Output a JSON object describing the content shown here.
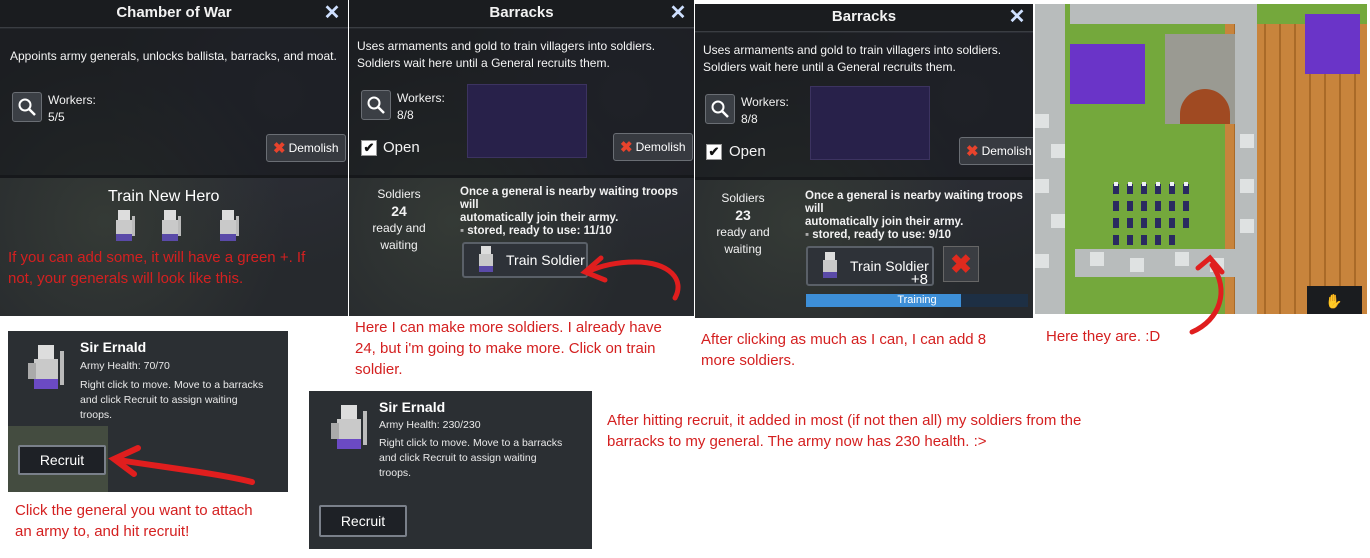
{
  "chamber": {
    "title": "Chamber of War",
    "description": "Appoints army generals, unlocks ballista, barracks, and moat.",
    "workers_label": "Workers:",
    "workers_value": "5/5",
    "demolish_label": "Demolish",
    "train_hero_label": "Train New Hero"
  },
  "barracks1": {
    "title": "Barracks",
    "description_line1": "Uses armaments and gold to train villagers into soldiers.",
    "description_line2": "Soldiers wait here until a General recruits them.",
    "workers_label": "Workers:",
    "workers_value": "8/8",
    "open_label": "Open",
    "demolish_label": "Demolish",
    "soldiers_label": "Soldiers",
    "soldiers_count": "24",
    "soldiers_sub1": "ready and",
    "soldiers_sub2": "waiting",
    "general_text_line1": "Once a general is nearby waiting troops will",
    "general_text_line2": "automatically join their army.",
    "stored_text": "stored, ready to use: 11/10",
    "train_label": "Train Soldier"
  },
  "barracks2": {
    "title": "Barracks",
    "description_line1": "Uses armaments and gold to train villagers into soldiers.",
    "description_line2": "Soldiers wait here until a General recruits them.",
    "workers_label": "Workers:",
    "workers_value": "8/8",
    "open_label": "Open",
    "demolish_label": "Demolish",
    "soldiers_label": "Soldiers",
    "soldiers_count": "23",
    "soldiers_sub1": "ready and",
    "soldiers_sub2": "waiting",
    "general_text_line1": "Once a general is nearby waiting troops will",
    "general_text_line2": "automatically join their army.",
    "stored_text": "stored, ready to use: 9/10",
    "train_label": "Train Soldier",
    "queue_count": "+8",
    "training_label": "Training",
    "training_progress": 0.7
  },
  "general1": {
    "name": "Sir Ernald",
    "health": "Army Health: 70/70",
    "line1": "Right click to move. Move to a barracks",
    "line2": "and click Recruit to assign waiting",
    "line3": "troops.",
    "recruit_label": "Recruit"
  },
  "general2": {
    "name": "Sir Ernald",
    "health": "Army Health: 230/230",
    "line1": "Right click to move. Move to a barracks",
    "line2": "and click Recruit to assign waiting",
    "line3": "troops.",
    "recruit_label": "Recruit"
  },
  "annotations": {
    "hero_note_line1": "If you can add some, it will have a green +. If",
    "hero_note_line2": "not, your generals will look like this.",
    "barracks_note_line1": "Here I can make more soldiers. I already have",
    "barracks_note_line2": "24, but i'm going to make more. Click on train",
    "barracks_note_line3": "soldier.",
    "training_note_line1": "After clicking as much as I can, I can add 8",
    "training_note_line2": "more soldiers.",
    "map_note": "Here they are. :D",
    "general_note_line1": "Click the general you want to attach",
    "general_note_line2": "an army to, and hit recruit!",
    "result_note_line1": "After hitting recruit, it added in most (if not then all) my soldiers from the",
    "result_note_line2": "barracks to my general. The army now has 230 health. :>"
  },
  "colors": {
    "annotation_red": "#d42020",
    "demolish_x": "#e8432c",
    "training_bar": "#3d8fd8"
  }
}
